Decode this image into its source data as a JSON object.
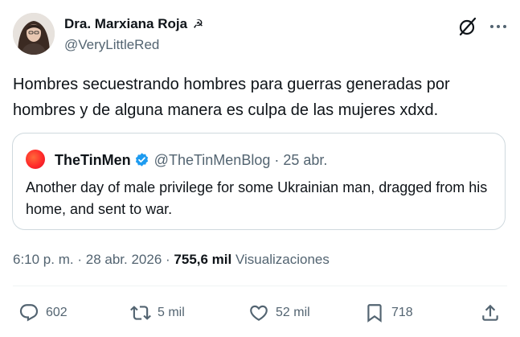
{
  "author": {
    "name": "Dra. Marxiana Roja",
    "name_emoji": "☭",
    "handle": "@VeryLittleRed"
  },
  "tweet": {
    "text": "Hombres secuestrando hombres para guerras generadas por hombres y de alguna manera es culpa de las mujeres xdxd."
  },
  "quote": {
    "name": "TheTinMen",
    "handle": "@TheTinMenBlog",
    "separator": "·",
    "date": "25 abr.",
    "text": "Another day of male privilege for some Ukrainian man, dragged from his home, and sent to war."
  },
  "meta": {
    "time": "6:10 p. m.",
    "separator": "·",
    "date": "28 abr. 2026",
    "separator2": "·",
    "views": "755,6 mil",
    "views_label": "Visualizaciones"
  },
  "actions": {
    "replies": "602",
    "reposts": "5 mil",
    "likes": "52 mil",
    "bookmarks": "718"
  },
  "icons": {
    "grok": "grok-icon",
    "more": "more-icon",
    "reply": "reply-icon",
    "repost": "repost-icon",
    "like": "heart-icon",
    "bookmark": "bookmark-icon",
    "share": "share-icon",
    "verified": "verified-badge-icon"
  },
  "colors": {
    "text": "#0f1419",
    "secondary": "#536471",
    "border": "#cfd9de",
    "verified": "#1d9bf0"
  }
}
